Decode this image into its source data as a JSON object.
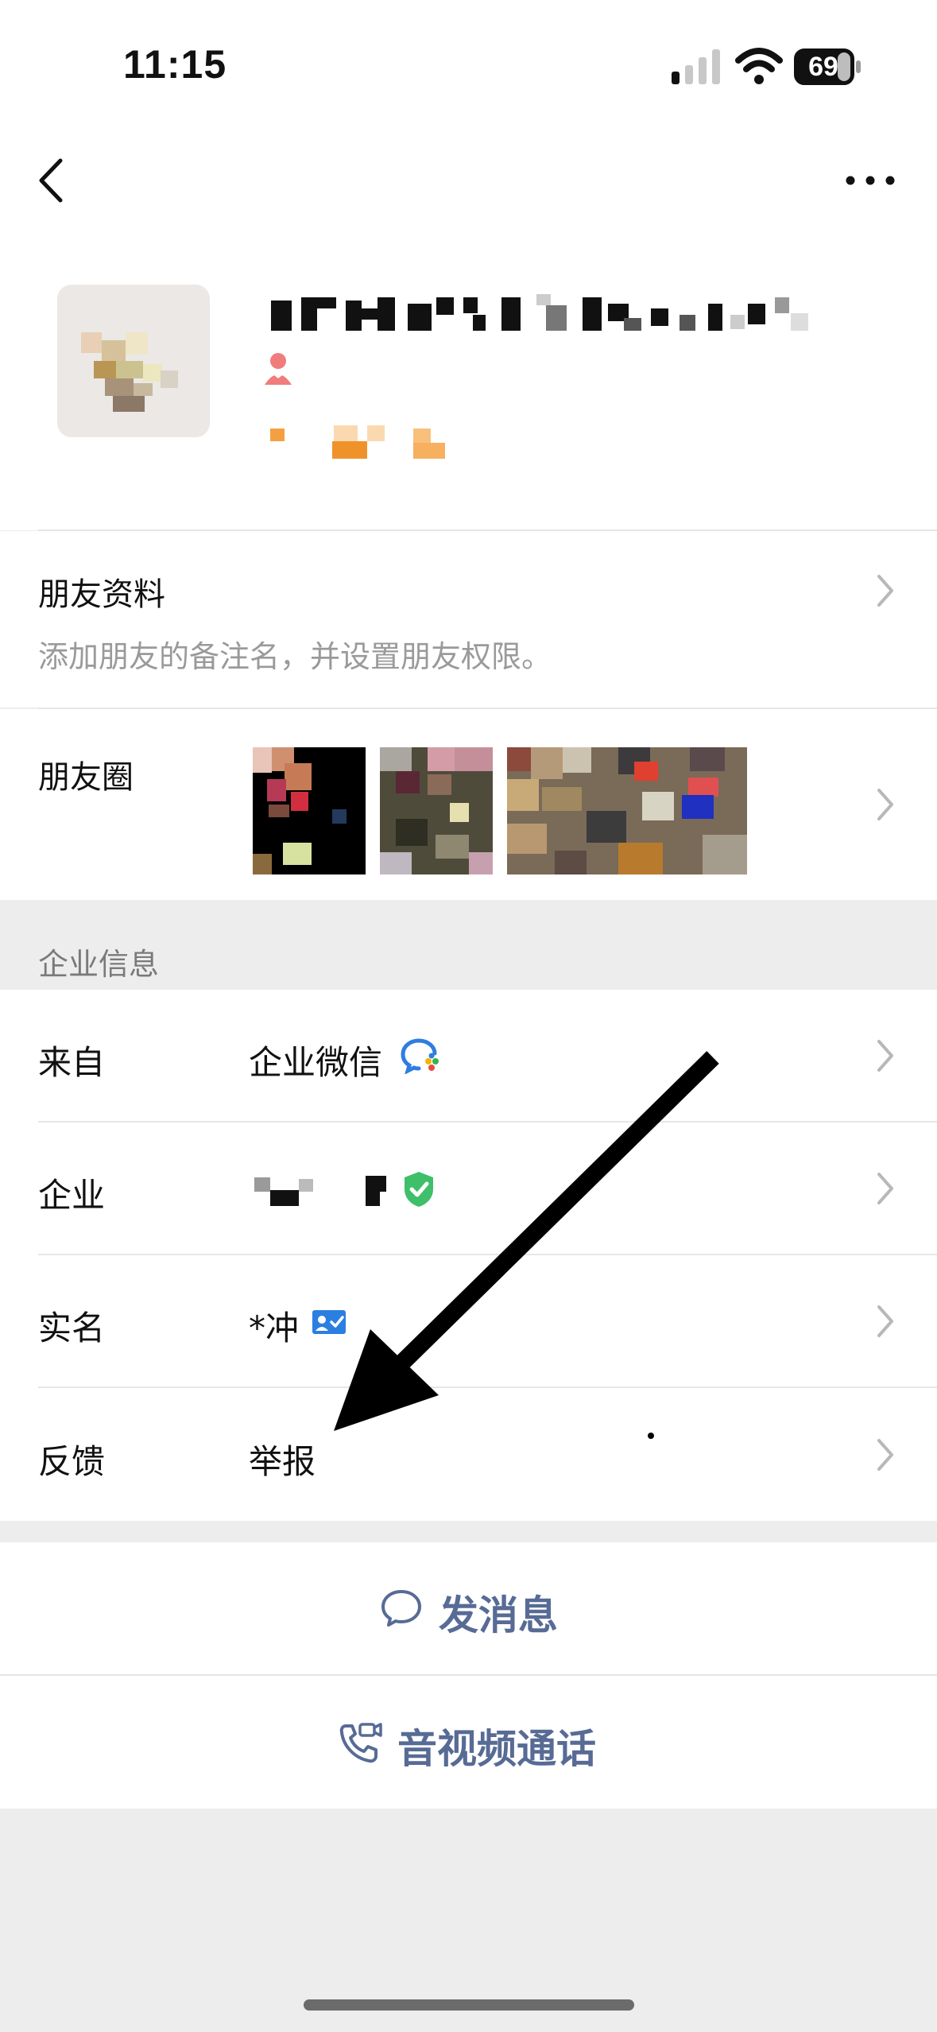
{
  "status_bar": {
    "time": "11:15",
    "battery": "69",
    "icons": [
      "signal-icon",
      "wifi-icon",
      "battery-icon"
    ]
  },
  "nav": {
    "back_icon": "chevron-left-icon",
    "more_icon": "ellipsis-icon"
  },
  "profile": {
    "avatar": "pixelated-avatar",
    "gender_icon": "female-icon",
    "accent_color": "#f07c7c"
  },
  "friend_info": {
    "title": "朋友资料",
    "subtitle": "添加朋友的备注名，并设置朋友权限。"
  },
  "moments": {
    "title": "朋友圈"
  },
  "enterprise": {
    "header": "企业信息",
    "rows": [
      {
        "label": "来自",
        "value": "企业微信",
        "icon": "wecom-logo-icon"
      },
      {
        "label": "企业",
        "value": "",
        "icon": "verified-shield-icon"
      },
      {
        "label": "实名",
        "value": "*冲",
        "icon": "id-card-icon"
      },
      {
        "label": "反馈",
        "value": "举报",
        "icon": ""
      }
    ]
  },
  "actions": {
    "message": {
      "label": "发消息",
      "icon": "chat-bubble-icon"
    },
    "call": {
      "label": "音视频通话",
      "icon": "video-call-icon"
    }
  },
  "colors": {
    "link": "#576b95",
    "background": "#ededed",
    "verified": "#3fbf6a",
    "id_badge": "#2b7fe0"
  }
}
